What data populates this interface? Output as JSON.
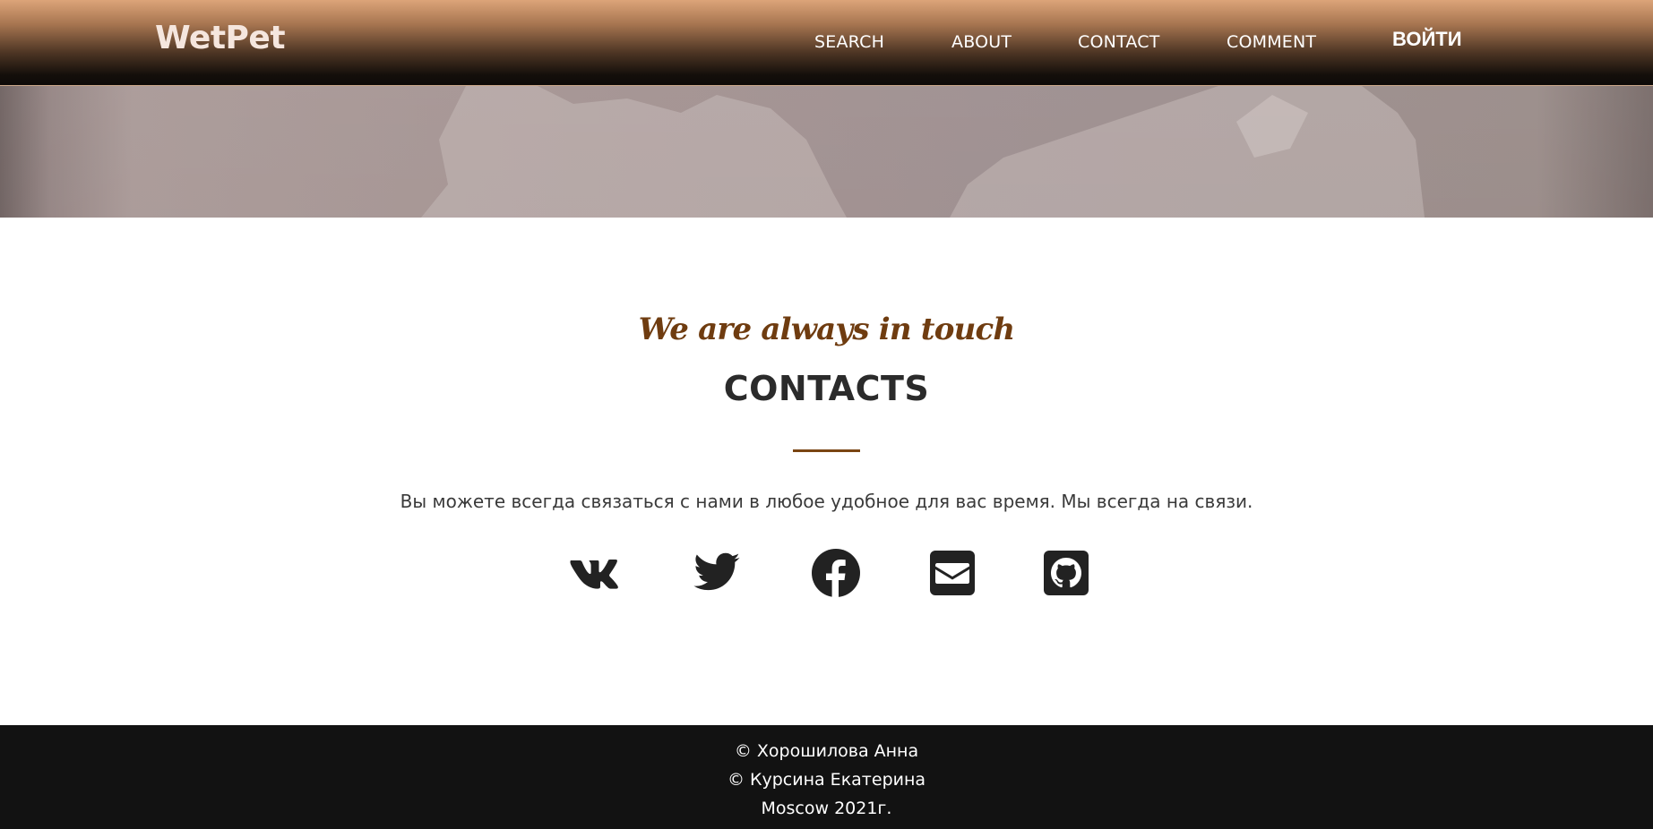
{
  "header": {
    "logo": "WetPet",
    "nav": {
      "search": "SEARCH",
      "about": "ABOUT",
      "contact": "CONTACT",
      "comment": "COMMENT"
    },
    "login": "ВОЙТИ"
  },
  "contacts": {
    "tagline": "We are always in touch",
    "title": "CONTACTS",
    "description": "Вы можете всегда связаться с нами в любое удобное для вас время. Мы всегда на связи.",
    "social": [
      "vk-icon",
      "twitter-icon",
      "facebook-icon",
      "envelope-icon",
      "github-icon"
    ],
    "accent_color": "#6f3c10"
  },
  "footer": {
    "line1": "© Хорошилова Анна",
    "line2": "© Курсина Екатерина",
    "line3": "Moscow 2021г."
  }
}
